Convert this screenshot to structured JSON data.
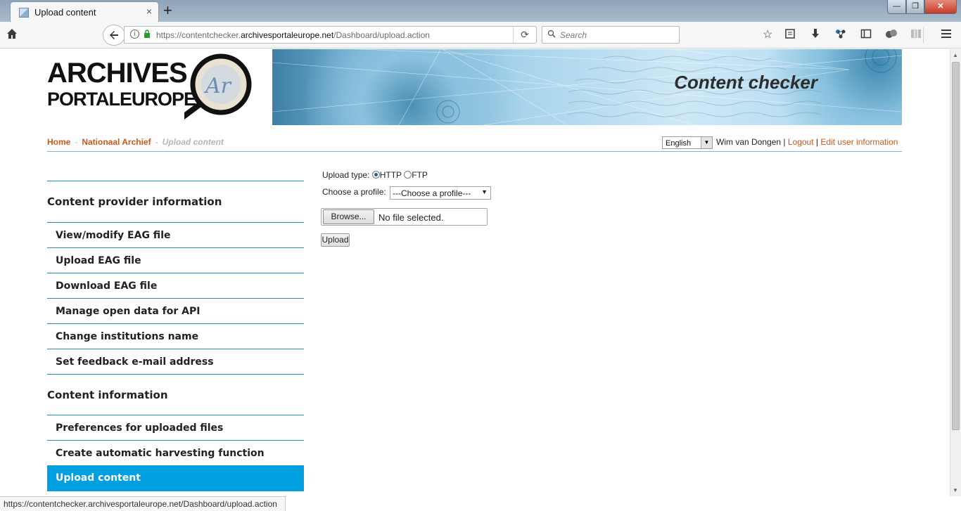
{
  "browser": {
    "tab_title": "Upload content",
    "tab_close": "×",
    "new_tab": "+",
    "window_controls": {
      "minimize": "—",
      "maximize": "❐",
      "close": "✕"
    },
    "url_prefix": "https://contentchecker.",
    "url_domain": "archivesportaleurope.net",
    "url_path": "/Dashboard/upload.action",
    "search_placeholder": "Search",
    "icons": [
      "home-icon",
      "back-icon",
      "info-icon",
      "lock-icon",
      "reload-icon",
      "search-icon",
      "star-icon",
      "reading-list-icon",
      "download-icon",
      "extension-icon",
      "sidebar-icon",
      "profile-icon",
      "library-icon",
      "menu-icon"
    ]
  },
  "header": {
    "logo_line1": "ARCHIVES",
    "logo_line2": "PORTALEUROPE",
    "banner_title": "Content checker"
  },
  "breadcrumb": {
    "home": "Home",
    "sep1": "-",
    "archive": "Nationaal Archief",
    "sep2": "-",
    "current": "Upload content"
  },
  "user": {
    "language": "English",
    "name": "Wim van Dongen",
    "sep1": " | ",
    "logout": "Logout",
    "sep2": " | ",
    "edit": "Edit user information"
  },
  "sidebar": {
    "section1": "Content provider information",
    "items1": [
      {
        "label": "View/modify EAG file"
      },
      {
        "label": "Upload EAG file"
      },
      {
        "label": "Download EAG file"
      },
      {
        "label": "Manage open data for API"
      },
      {
        "label": "Change institutions name"
      },
      {
        "label": "Set feedback e-mail address"
      }
    ],
    "section2": "Content information",
    "items2": [
      {
        "label": "Preferences for uploaded files"
      },
      {
        "label": "Create automatic harvesting function"
      },
      {
        "label": "Upload content"
      }
    ]
  },
  "form": {
    "upload_type_label": "Upload type:",
    "option_http": "HTTP",
    "option_ftp": "FTP",
    "selected_type": "HTTP",
    "profile_label": "Choose a profile:",
    "profile_value": "---Choose a profile---",
    "browse_label": "Browse...",
    "file_status": "No file selected.",
    "upload_label": "Upload"
  },
  "status_bar": "https://contentchecker.archivesportaleurope.net/Dashboard/upload.action",
  "colors": {
    "link": "#c65a1e",
    "active_nav": "#009fdf",
    "divider": "#2a89b5"
  }
}
